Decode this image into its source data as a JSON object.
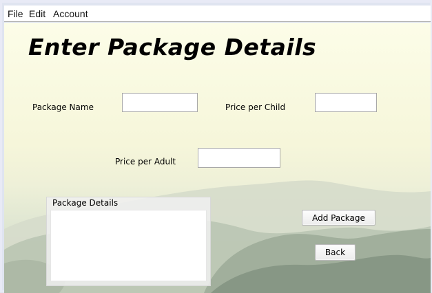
{
  "menubar": {
    "items": [
      "File",
      "Edit",
      "Account"
    ]
  },
  "title": "Enter Package Details",
  "fields": {
    "package_name": {
      "label": "Package Name",
      "value": ""
    },
    "price_child": {
      "label": "Price per Child",
      "value": ""
    },
    "price_adult": {
      "label": "Price per Adult",
      "value": ""
    }
  },
  "details_group": {
    "legend": "Package Details"
  },
  "buttons": {
    "add_package": "Add Package",
    "back": "Back"
  }
}
